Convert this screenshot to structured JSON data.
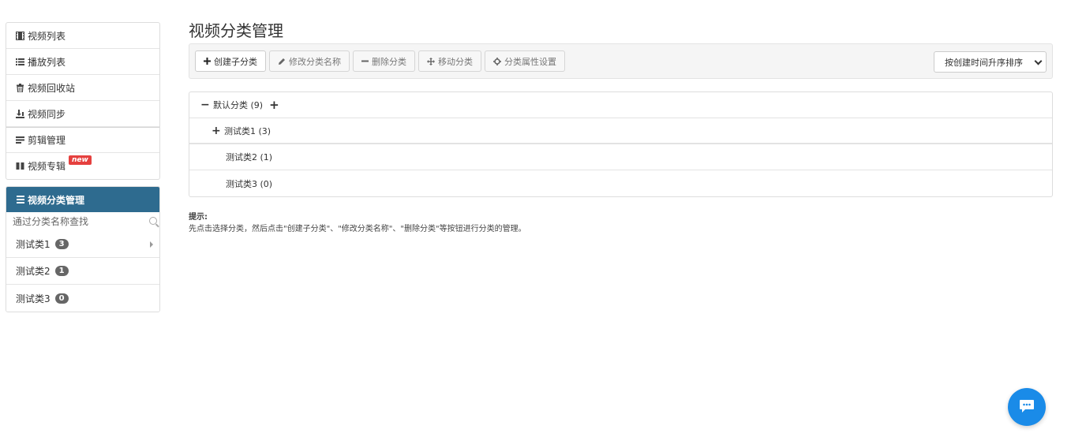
{
  "sidebar": {
    "menu": [
      {
        "label": "视频列表",
        "icon": "film-icon"
      },
      {
        "label": "播放列表",
        "icon": "list-icon"
      },
      {
        "label": "视频回收站",
        "icon": "trash-icon"
      },
      {
        "label": "视频同步",
        "icon": "sync-icon"
      },
      {
        "label": "剪辑管理",
        "icon": "edit-stack-icon"
      },
      {
        "label": "视频专辑",
        "icon": "columns-icon",
        "badge": "new"
      }
    ],
    "category_panel": {
      "title": "视频分类管理",
      "search_placeholder": "通过分类名称查找",
      "items": [
        {
          "label": "测试类1",
          "count": "3",
          "has_children": true
        },
        {
          "label": "测试类2",
          "count": "1"
        },
        {
          "label": "测试类3",
          "count": "0"
        }
      ]
    }
  },
  "main": {
    "title": "视频分类管理",
    "toolbar": {
      "create_label": "创建子分类",
      "rename_label": "修改分类名称",
      "delete_label": "删除分类",
      "move_label": "移动分类",
      "props_label": "分类属性设置",
      "sort_value": "按创建时间升序排序"
    },
    "tree": [
      {
        "label": "默认分类 (9)",
        "level": 0,
        "expanded": true
      },
      {
        "label": "测试类1 (3)",
        "level": 1,
        "expanded": false
      },
      {
        "label": "测试类2 (1)",
        "level": 1
      },
      {
        "label": "测试类3 (0)",
        "level": 1
      }
    ],
    "hint": {
      "title": "提示:",
      "text": "先点击选择分类，然后点击\"创建子分类\"、\"修改分类名称\"、\"删除分类\"等按钮进行分类的管理。"
    }
  },
  "colors": {
    "panel_header": "#2e6b8f",
    "badge_new": "#e5403e",
    "chat_button": "#1a8be8"
  }
}
